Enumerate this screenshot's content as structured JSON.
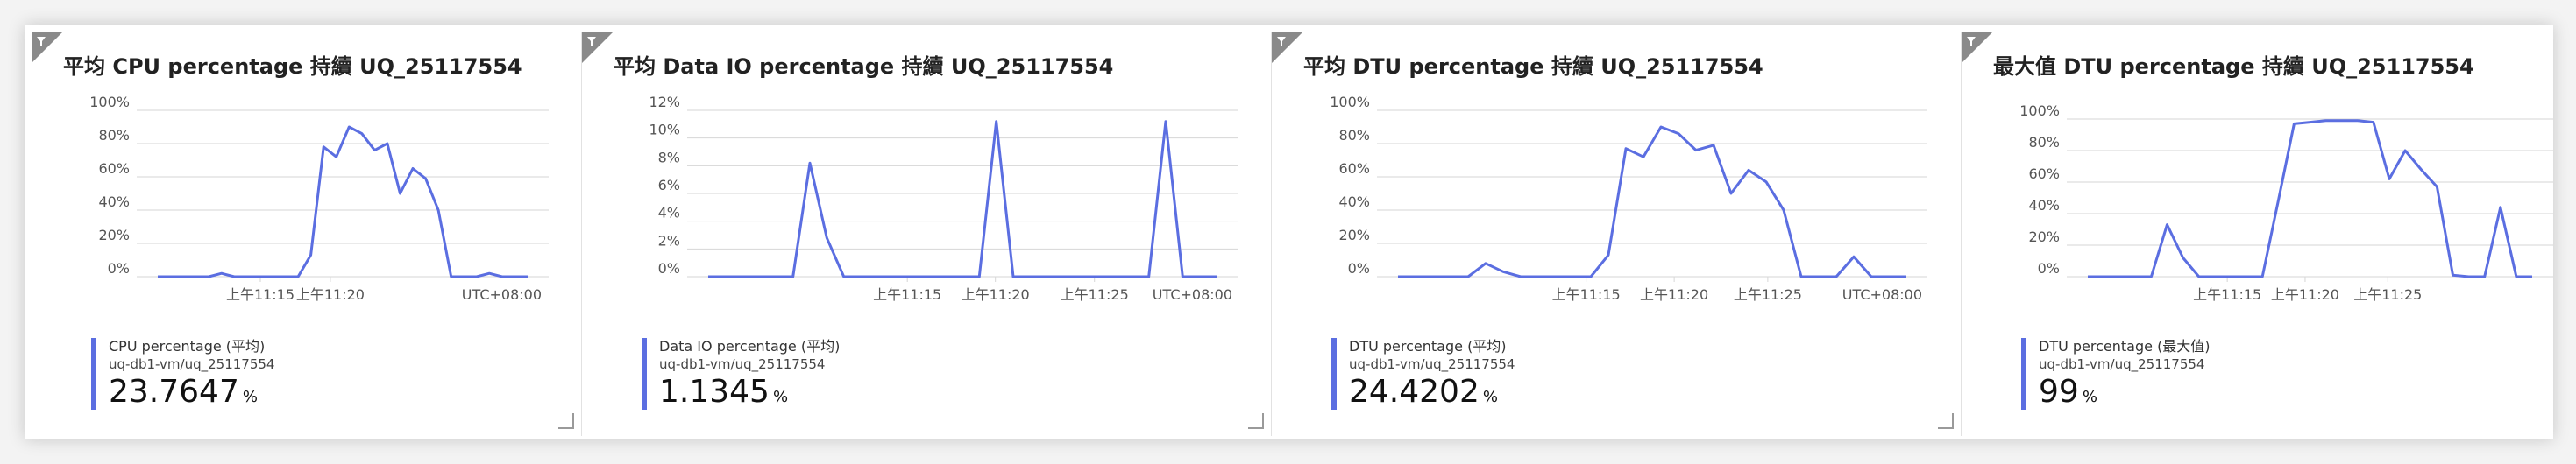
{
  "tiles": [
    {
      "title": "平均 CPU percentage 持續 UQ_25117554",
      "filter_icon": "filter-icon",
      "chart_data": {
        "type": "line",
        "yticks": [
          "100%",
          "80%",
          "60%",
          "40%",
          "20%",
          "0%"
        ],
        "ylim": [
          0,
          100
        ],
        "xticks": [
          "上午11:15",
          "上午11:20"
        ],
        "timezone": "UTC+08:00",
        "series": [
          {
            "name": "CPU percentage (平均)",
            "values": [
              0,
              0,
              0,
              0,
              0,
              2,
              0,
              0,
              0,
              0,
              0,
              0,
              13,
              78,
              72,
              90,
              86,
              76,
              80,
              50,
              65,
              59,
              40,
              0,
              0,
              0,
              2,
              0,
              0,
              0
            ]
          }
        ]
      },
      "legend": {
        "name": "CPU percentage (平均)",
        "resource": "uq-db1-vm/uq_25117554",
        "value": "23.7647",
        "unit": "%"
      }
    },
    {
      "title": "平均 Data IO percentage 持續 UQ_25117554",
      "filter_icon": "filter-icon",
      "chart_data": {
        "type": "line",
        "yticks": [
          "12%",
          "10%",
          "8%",
          "6%",
          "4%",
          "2%",
          "0%"
        ],
        "ylim": [
          0,
          12
        ],
        "xticks": [
          "上午11:15",
          "上午11:20",
          "上午11:25"
        ],
        "timezone": "UTC+08:00",
        "series": [
          {
            "name": "Data IO percentage (平均)",
            "values": [
              0,
              0,
              0,
              0,
              0,
              0,
              8.2,
              2.8,
              0,
              0,
              0,
              0,
              0,
              0,
              0,
              0,
              0,
              11.2,
              0,
              0,
              0,
              0,
              0,
              0,
              0,
              0,
              0,
              11.2,
              0,
              0,
              0
            ]
          }
        ]
      },
      "legend": {
        "name": "Data IO percentage (平均)",
        "resource": "uq-db1-vm/uq_25117554",
        "value": "1.1345",
        "unit": "%"
      }
    },
    {
      "title": "平均 DTU percentage 持續 UQ_25117554",
      "filter_icon": "filter-icon",
      "chart_data": {
        "type": "line",
        "yticks": [
          "100%",
          "80%",
          "60%",
          "40%",
          "20%",
          "0%"
        ],
        "ylim": [
          0,
          100
        ],
        "xticks": [
          "上午11:15",
          "上午11:20",
          "上午11:25"
        ],
        "timezone": "UTC+08:00",
        "series": [
          {
            "name": "DTU percentage (平均)",
            "values": [
              0,
              0,
              0,
              0,
              0,
              8,
              3,
              0,
              0,
              0,
              0,
              0,
              13,
              77,
              72,
              90,
              86,
              76,
              79,
              50,
              64,
              57,
              40,
              0,
              0,
              0,
              12,
              0,
              0,
              0
            ]
          }
        ]
      },
      "legend": {
        "name": "DTU percentage (平均)",
        "resource": "uq-db1-vm/uq_25117554",
        "value": "24.4202",
        "unit": "%"
      }
    },
    {
      "title": "最大值 DTU percentage 持續 UQ_25117554",
      "filter_icon": "filter-icon",
      "chart_data": {
        "type": "line",
        "yticks": [
          "100%",
          "80%",
          "60%",
          "40%",
          "20%",
          "0%"
        ],
        "ylim": [
          0,
          100
        ],
        "xticks": [
          "上午11:15",
          "上午11:20",
          "上午11:25"
        ],
        "timezone": "",
        "series": [
          {
            "name": "DTU percentage (最大值)",
            "values": [
              0,
              0,
              0,
              0,
              0,
              33,
              12,
              0,
              0,
              0,
              0,
              0,
              48,
              97,
              98,
              99,
              99,
              99,
              98,
              62,
              80,
              68,
              57,
              1,
              0,
              0,
              44,
              0,
              0
            ]
          }
        ]
      },
      "legend": {
        "name": "DTU percentage (最大值)",
        "resource": "uq-db1-vm/uq_25117554",
        "value": "99",
        "unit": "%"
      }
    }
  ],
  "colors": {
    "line": "#5b6ee1",
    "grid": "#d6d6d6",
    "axis_text": "#555555",
    "legend_bar": "#5b6ee1"
  }
}
